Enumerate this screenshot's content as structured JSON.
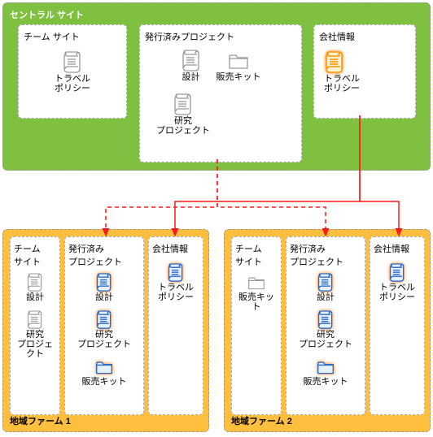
{
  "central": {
    "title": "セントラル サイト",
    "team": {
      "title": "チーム サイト",
      "items": [
        {
          "icon": "scroll-gray",
          "label": "トラベル\nポリシー"
        }
      ]
    },
    "published": {
      "title": "発行済みプロジェクト",
      "row1": [
        {
          "icon": "scroll-gray",
          "label": "設計"
        },
        {
          "icon": "folder-gray",
          "label": "販売キット"
        }
      ],
      "row2": [
        {
          "icon": "scroll-gray",
          "label": "研究\nプロジェクト"
        }
      ]
    },
    "company": {
      "title": "会社情報",
      "items": [
        {
          "icon": "scroll-orange",
          "label": "トラベル\nポリシー"
        }
      ]
    }
  },
  "farms": [
    {
      "title": "地域ファーム 1",
      "cols": [
        {
          "title": "チーム\nサイト",
          "items": [
            {
              "icon": "scroll-gray",
              "label": "設計"
            },
            {
              "icon": "scroll-gray",
              "label": "研究\nプロジェクト"
            }
          ]
        },
        {
          "title": "発行済み\nプロジェクト",
          "items": [
            {
              "icon": "scroll-orange-blue",
              "label": "設計"
            },
            {
              "icon": "scroll-orange-blue",
              "label": "研究\nプロジェクト"
            },
            {
              "icon": "folder-orange-blue",
              "label": "販売キット"
            }
          ]
        },
        {
          "title": "会社情報",
          "items": [
            {
              "icon": "scroll-orange-blue",
              "label": "トラベル\nポリシー"
            }
          ]
        }
      ]
    },
    {
      "title": "地域ファーム 2",
      "cols": [
        {
          "title": "チーム\nサイト",
          "items": [
            {
              "icon": "folder-gray",
              "label": "販売キット"
            }
          ]
        },
        {
          "title": "発行済み\nプロジェクト",
          "items": [
            {
              "icon": "scroll-orange-blue",
              "label": "設計"
            },
            {
              "icon": "scroll-orange-blue",
              "label": "研究\nプロジェクト"
            },
            {
              "icon": "folder-orange-blue",
              "label": "販売キット"
            }
          ]
        },
        {
          "title": "会社情報",
          "items": [
            {
              "icon": "scroll-orange-blue",
              "label": "トラベル\nポリシー"
            }
          ]
        }
      ]
    }
  ]
}
